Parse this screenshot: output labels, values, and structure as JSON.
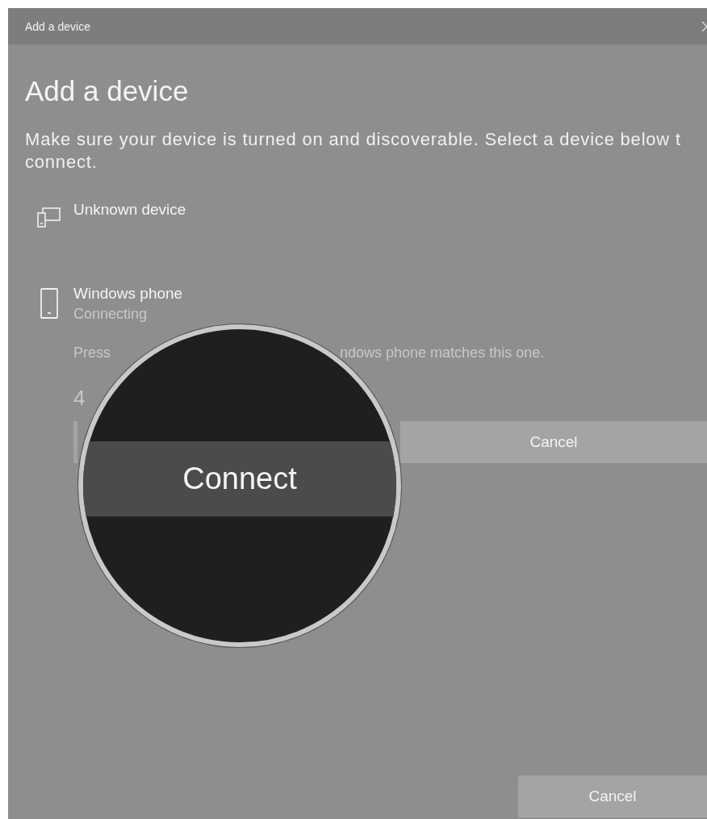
{
  "window": {
    "title": "Add a device"
  },
  "heading": "Add a device",
  "description": [
    "Make sure your device is turned on and discoverable. Select a device below t",
    "connect."
  ],
  "devices": [
    {
      "kind": "display",
      "name": "Unknown device"
    },
    {
      "kind": "phone",
      "name": "Windows phone",
      "status": "Connecting",
      "prompt_parts": [
        "Press",
        "ndows phone matches this one."
      ],
      "pin": "4",
      "buttons": [
        "Cancel"
      ]
    }
  ],
  "magnifier": {
    "label": "Connect"
  },
  "footer": {
    "button": "Cancel"
  }
}
